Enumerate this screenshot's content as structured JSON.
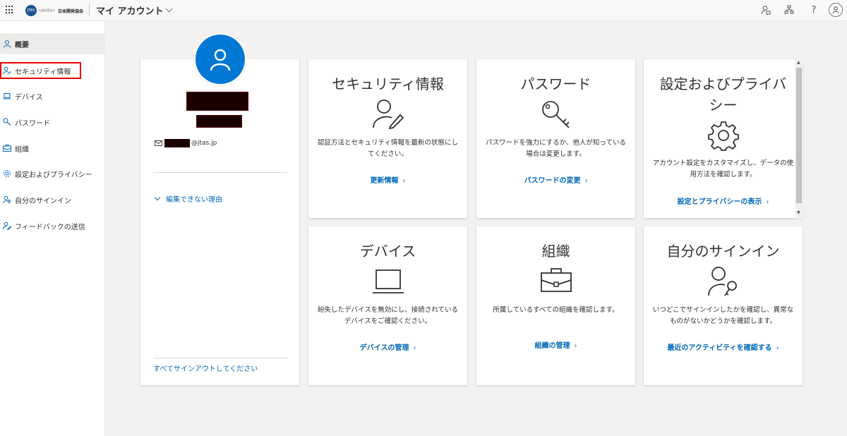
{
  "header": {
    "logo_circle": "JTAS",
    "logo_sub": "公益社団法人",
    "logo_text": "日本開発協会",
    "app_title": "マイ アカウント",
    "help_glyph": "?"
  },
  "sidebar": {
    "items": [
      {
        "label": "概要",
        "icon": "person-icon"
      },
      {
        "label": "セキュリティ情報",
        "icon": "person-key-icon"
      },
      {
        "label": "デバイス",
        "icon": "laptop-icon"
      },
      {
        "label": "パスワード",
        "icon": "key-icon"
      },
      {
        "label": "組織",
        "icon": "briefcase-icon"
      },
      {
        "label": "設定およびプライバシー",
        "icon": "gear-icon"
      },
      {
        "label": "自分のサインイン",
        "icon": "person-key-icon"
      },
      {
        "label": "フィードバックの送信",
        "icon": "feedback-icon"
      }
    ]
  },
  "profile": {
    "email_domain": "@jtas.jp",
    "why_cant_edit": "編集できない理由",
    "sign_out_all": "すべてサインアウトしてください"
  },
  "tiles": {
    "security": {
      "title": "セキュリティ情報",
      "desc": "認証方法とセキュリティ情報を最新の状態にしてください。",
      "link": "更新情報"
    },
    "password": {
      "title": "パスワード",
      "desc": "パスワードを強力にするか、他人が知っている場合は変更します。",
      "link": "パスワードの変更"
    },
    "settings": {
      "title_line1": "設定およびプライバ",
      "title_line2": "シー",
      "desc": "アカウント設定をカスタマイズし、データの使用方法を確認します。",
      "link": "設定とプライバシーの表示"
    },
    "devices": {
      "title": "デバイス",
      "desc": "紛失したデバイスを無効にし、接続されているデバイスをご確認ください。",
      "link": "デバイスの管理"
    },
    "organizations": {
      "title": "組織",
      "desc": "所属しているすべての組織を確認します。",
      "link": "組織の管理"
    },
    "signins": {
      "title": "自分のサインイン",
      "desc": "いつどこでサインインしたかを確認し、異常なものがないかどうかを確認します。",
      "link": "最近のアクティビティを確認する"
    },
    "arrow": "›"
  },
  "colors": {
    "accent": "#0067b8",
    "avatar_bg": "#0078d4",
    "highlight": "#e00000"
  }
}
